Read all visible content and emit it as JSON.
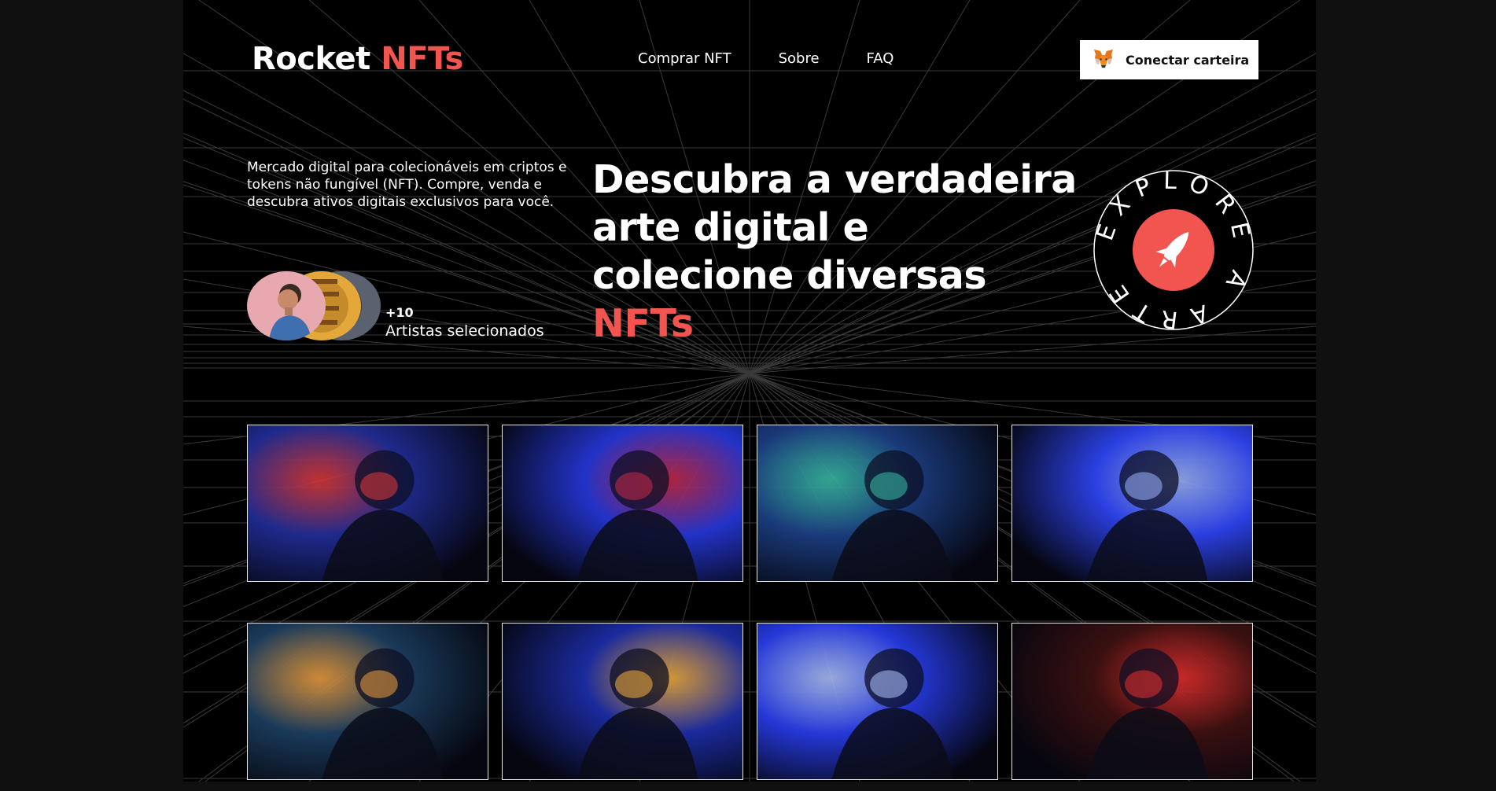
{
  "header": {
    "logo": {
      "text": "Rocket",
      "accent": "NFTs"
    },
    "nav": [
      {
        "label": "Comprar NFT"
      },
      {
        "label": "Sobre"
      },
      {
        "label": "FAQ"
      }
    ],
    "wallet_button": {
      "label": "Conectar carteira",
      "icon": "metamask-fox-icon"
    }
  },
  "hero": {
    "intro": "Mercado digital para colecionáveis em criptos e tokens não fungível (NFT). Compre, venda e descubra ativos digitais exclusivos para você.",
    "artists": {
      "count": "+10",
      "label": "Artistas selecionados"
    },
    "headline": "Descubra a verdadeira arte digital e colecione diversas",
    "headline_accent": "NFTs",
    "badge": {
      "circular_text": "EXPLORE A ARTE",
      "icon": "rocket-icon"
    }
  },
  "gallery": {
    "items": [
      {
        "alt": "astronaut-1",
        "tint": "#1e2a8c",
        "glow": "#e03a3a"
      },
      {
        "alt": "astronaut-2",
        "tint": "#2233c8",
        "glow": "#c92a4a"
      },
      {
        "alt": "astronaut-3",
        "tint": "#1a3a7a",
        "glow": "#3ac0a8"
      },
      {
        "alt": "astronaut-4",
        "tint": "#2a3fe0",
        "glow": "#9cb4ff"
      },
      {
        "alt": "astronaut-5",
        "tint": "#1a3a5a",
        "glow": "#f0a040"
      },
      {
        "alt": "astronaut-6",
        "tint": "#1a2a9c",
        "glow": "#f5b040"
      },
      {
        "alt": "astronaut-7",
        "tint": "#2438d8",
        "glow": "#b0c4ff"
      },
      {
        "alt": "astronaut-8",
        "tint": "#3a1010",
        "glow": "#e83030"
      }
    ]
  },
  "colors": {
    "accent": "#f2554f",
    "background": "#000000",
    "text": "#ffffff"
  }
}
